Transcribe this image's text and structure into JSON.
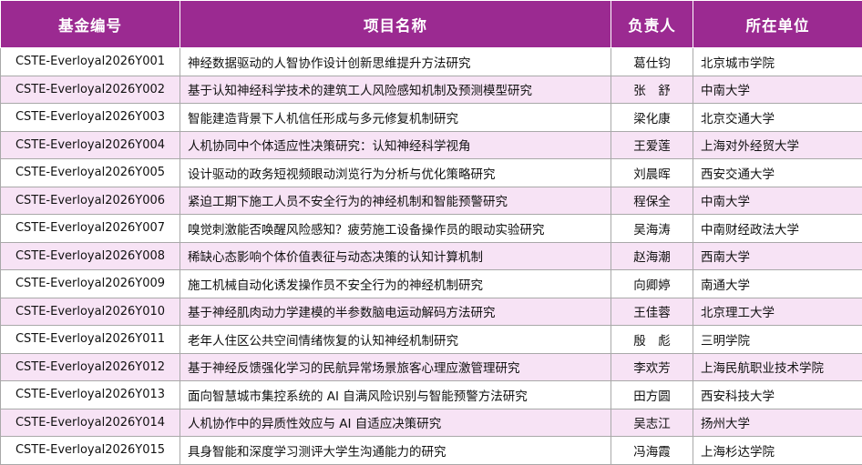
{
  "table": {
    "headers": [
      "基金编号",
      "项目名称",
      "负责人",
      "所在单位"
    ],
    "rows": [
      {
        "id": "CSTE-Everloyal2026Y001",
        "title": "神经数据驱动的人智协作设计创新思维提升方法研究",
        "person": "葛仕钧",
        "unit": "北京城市学院"
      },
      {
        "id": "CSTE-Everloyal2026Y002",
        "title": "基于认知神经科学技术的建筑工人风险感知机制及预测模型研究",
        "person": "张　舒",
        "unit": "中南大学"
      },
      {
        "id": "CSTE-Everloyal2026Y003",
        "title": "智能建造背景下人机信任形成与多元修复机制研究",
        "person": "梁化康",
        "unit": "北京交通大学"
      },
      {
        "id": "CSTE-Everloyal2026Y004",
        "title": "人机协同中个体适应性决策研究：认知神经科学视角",
        "person": "王爱莲",
        "unit": "上海对外经贸大学"
      },
      {
        "id": "CSTE-Everloyal2026Y005",
        "title": "设计驱动的政务短视频眼动浏览行为分析与优化策略研究",
        "person": "刘晨晖",
        "unit": "西安交通大学"
      },
      {
        "id": "CSTE-Everloyal2026Y006",
        "title": "紧迫工期下施工人员不安全行为的神经机制和智能预警研究",
        "person": "程保全",
        "unit": "中南大学"
      },
      {
        "id": "CSTE-Everloyal2026Y007",
        "title": "嗅觉刺激能否唤醒风险感知？疲劳施工设备操作员的眼动实验研究",
        "person": "吴海涛",
        "unit": "中南财经政法大学"
      },
      {
        "id": "CSTE-Everloyal2026Y008",
        "title": "稀缺心态影响个体价值表征与动态决策的认知计算机制",
        "person": "赵海潮",
        "unit": "西南大学"
      },
      {
        "id": "CSTE-Everloyal2026Y009",
        "title": "施工机械自动化诱发操作员不安全行为的神经机制研究",
        "person": "向卿婷",
        "unit": "南通大学"
      },
      {
        "id": "CSTE-Everloyal2026Y010",
        "title": "基于神经肌肉动力学建模的半参数脑电运动解码方法研究",
        "person": "王佳蓉",
        "unit": "北京理工大学"
      },
      {
        "id": "CSTE-Everloyal2026Y011",
        "title": "老年人住区公共空间情绪恢复的认知神经机制研究",
        "person": "殷　彪",
        "unit": "三明学院"
      },
      {
        "id": "CSTE-Everloyal2026Y012",
        "title": "基于神经反馈强化学习的民航异常场景旅客心理应激管理研究",
        "person": "李欢芳",
        "unit": "上海民航职业技术学院"
      },
      {
        "id": "CSTE-Everloyal2026Y013",
        "title": "面向智慧城市集控系统的 AI 自满风险识别与智能预警方法研究",
        "person": "田方圆",
        "unit": "西安科技大学"
      },
      {
        "id": "CSTE-Everloyal2026Y014",
        "title": "人机协作中的异质性效应与 AI 自适应决策研究",
        "person": "吴志江",
        "unit": "扬州大学"
      },
      {
        "id": "CSTE-Everloyal2026Y015",
        "title": "具身智能和深度学习测评大学生沟通能力的研究",
        "person": "冯海霞",
        "unit": "上海杉达学院"
      }
    ]
  },
  "colors": {
    "header_bg": "#9b2a91",
    "header_text": "#ffffff",
    "row_alt_bg": "#f7e3f5",
    "row_bg": "#ffffff",
    "grid": "#a9a9a9"
  }
}
